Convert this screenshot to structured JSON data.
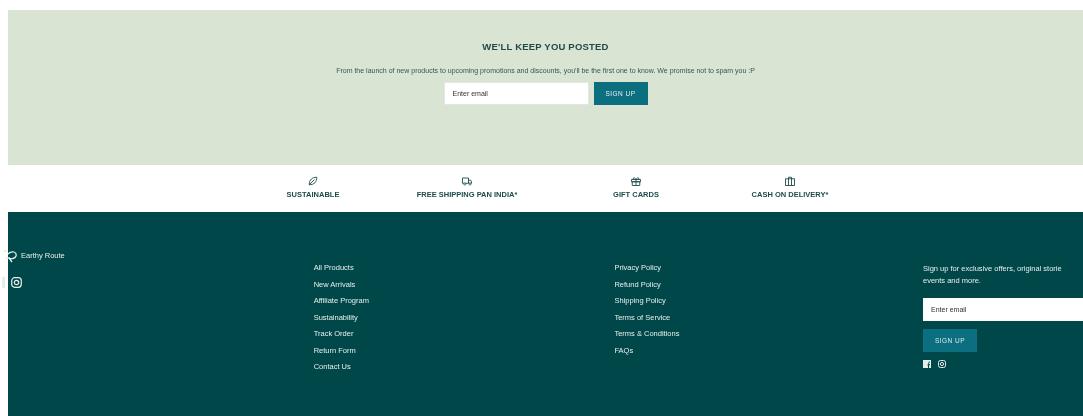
{
  "newsletter": {
    "title": "WE'LL KEEP YOU POSTED",
    "text": "From the launch of new products to upcoming promotions and discounts, you'll be the first one to know. We promise not to spam you :P",
    "placeholder": "Enter email",
    "button": "SIGN UP"
  },
  "features": [
    {
      "kind": "leaf",
      "label": "SUSTAINABLE"
    },
    {
      "kind": "truck",
      "label": "FREE SHIPPING PAN INDIA*"
    },
    {
      "kind": "gift",
      "label": "GIFT CARDS"
    },
    {
      "kind": "bag",
      "label": "CASH ON DELIVERY*"
    }
  ],
  "footer": {
    "brand": "Earthy Route",
    "links_1": [
      "All Products",
      "New Arrivals",
      "Affiliate Program",
      "Sustainability",
      "Track Order",
      "Return Form",
      "Contact Us"
    ],
    "links_2": [
      "Privacy Policy",
      "Refund Policy",
      "Shipping Policy",
      "Terms of Service",
      "Terms & Conditions",
      "FAQs"
    ],
    "signup": {
      "lines": [
        "Sign up for exclusive offers, original storie",
        "events and more."
      ],
      "placeholder": "Enter email",
      "button": "SIGN UP"
    }
  }
}
